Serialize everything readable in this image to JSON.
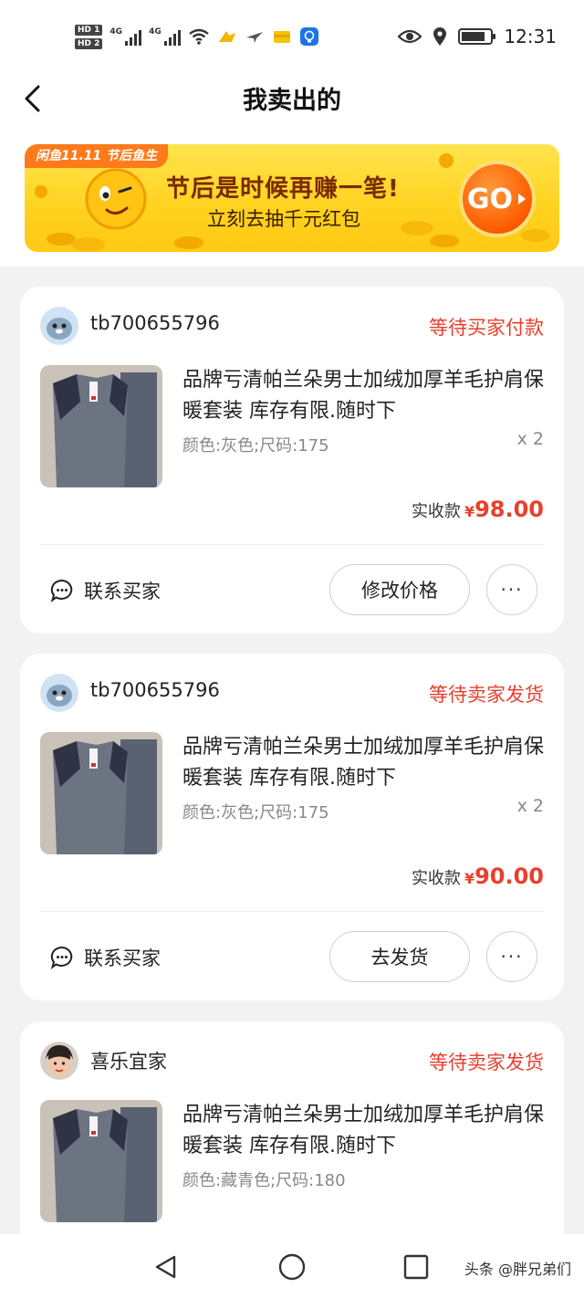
{
  "status_bar": {
    "hd1": "HD 1",
    "hd2": "HD 2",
    "net1": "4G",
    "net2": "4G",
    "time": "12:31"
  },
  "header": {
    "title": "我卖出的"
  },
  "banner": {
    "tag": "闲鱼11.11 节后鱼生",
    "headline": "节后是时候再赚一笔!",
    "subline": "立刻去抽千元红包",
    "go_label": "GO"
  },
  "orders": [
    {
      "buyer": "tb700655796",
      "status": "等待买家付款",
      "title": "品牌亏清帕兰朵男士加绒加厚羊毛护肩保暖套装 库存有限.随时下",
      "spec": "颜色:灰色;尺码:175",
      "qty": "x 2",
      "paid_label": "实收款",
      "currency": "¥",
      "price": "98.00",
      "contact_label": "联系买家",
      "action_label": "修改价格",
      "more_label": "···"
    },
    {
      "buyer": "tb700655796",
      "status": "等待卖家发货",
      "title": "品牌亏清帕兰朵男士加绒加厚羊毛护肩保暖套装 库存有限.随时下",
      "spec": "颜色:灰色;尺码:175",
      "qty": "x 2",
      "paid_label": "实收款",
      "currency": "¥",
      "price": "90.00",
      "contact_label": "联系买家",
      "action_label": "去发货",
      "more_label": "···"
    },
    {
      "buyer": "喜乐宜家",
      "status": "等待卖家发货",
      "title": "品牌亏清帕兰朵男士加绒加厚羊毛护肩保暖套装 库存有限.随时下",
      "spec": "颜色:藏青色;尺码:180"
    }
  ],
  "watermark": "头条 @胖兄弟们",
  "colors": {
    "accent_red": "#e8402c",
    "banner_yellow": "#ffd21f",
    "go_orange": "#ff5a00"
  }
}
